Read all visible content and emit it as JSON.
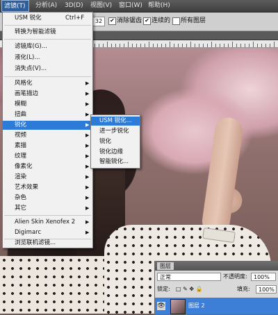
{
  "menubar": {
    "items": [
      "滤镜(T)",
      "分析(A)",
      "3D(D)",
      "视图(V)",
      "窗口(W)",
      "帮助(H)"
    ]
  },
  "options": {
    "value": "32",
    "checkboxes": [
      {
        "label": "消除锯齿",
        "checked": true
      },
      {
        "label": "连续的",
        "checked": true
      },
      {
        "label": "所有图层",
        "checked": false
      }
    ]
  },
  "filter_menu": {
    "items": [
      {
        "label": "USM 锐化",
        "shortcut": "Ctrl+F"
      },
      {
        "label": "转换为智能滤镜"
      },
      {
        "label": "滤镜库(G)..."
      },
      {
        "label": "液化(L)..."
      },
      {
        "label": "消失点(V)..."
      },
      {
        "label": "风格化",
        "submenu": true
      },
      {
        "label": "画笔描边",
        "submenu": true
      },
      {
        "label": "模糊",
        "submenu": true
      },
      {
        "label": "扭曲",
        "submenu": true
      },
      {
        "label": "锐化",
        "submenu": true,
        "highlighted": true
      },
      {
        "label": "视频",
        "submenu": true
      },
      {
        "label": "素描",
        "submenu": true
      },
      {
        "label": "纹理",
        "submenu": true
      },
      {
        "label": "像素化",
        "submenu": true
      },
      {
        "label": "渲染",
        "submenu": true
      },
      {
        "label": "艺术效果",
        "submenu": true
      },
      {
        "label": "杂色",
        "submenu": true
      },
      {
        "label": "其它",
        "submenu": true
      },
      {
        "label": "Alien Skin Xenofex 2",
        "submenu": true
      },
      {
        "label": "Digimarc",
        "submenu": true
      },
      {
        "label": "浏览联机滤镜..."
      }
    ]
  },
  "sharpen_submenu": {
    "items": [
      "USM 锐化...",
      "进一步锐化",
      "锐化",
      "锐化边缘",
      "智能锐化..."
    ]
  },
  "layers_panel": {
    "tab": "图层",
    "blend_mode": "正常",
    "opacity_label": "不透明度:",
    "opacity_value": "100%",
    "lock_label": "锁定:",
    "fill_label": "填充:",
    "fill_value": "100%",
    "layer_name": "图层 2"
  },
  "colors": {
    "highlight": "#2d7bd8",
    "menubar": "#4a4a4a"
  }
}
